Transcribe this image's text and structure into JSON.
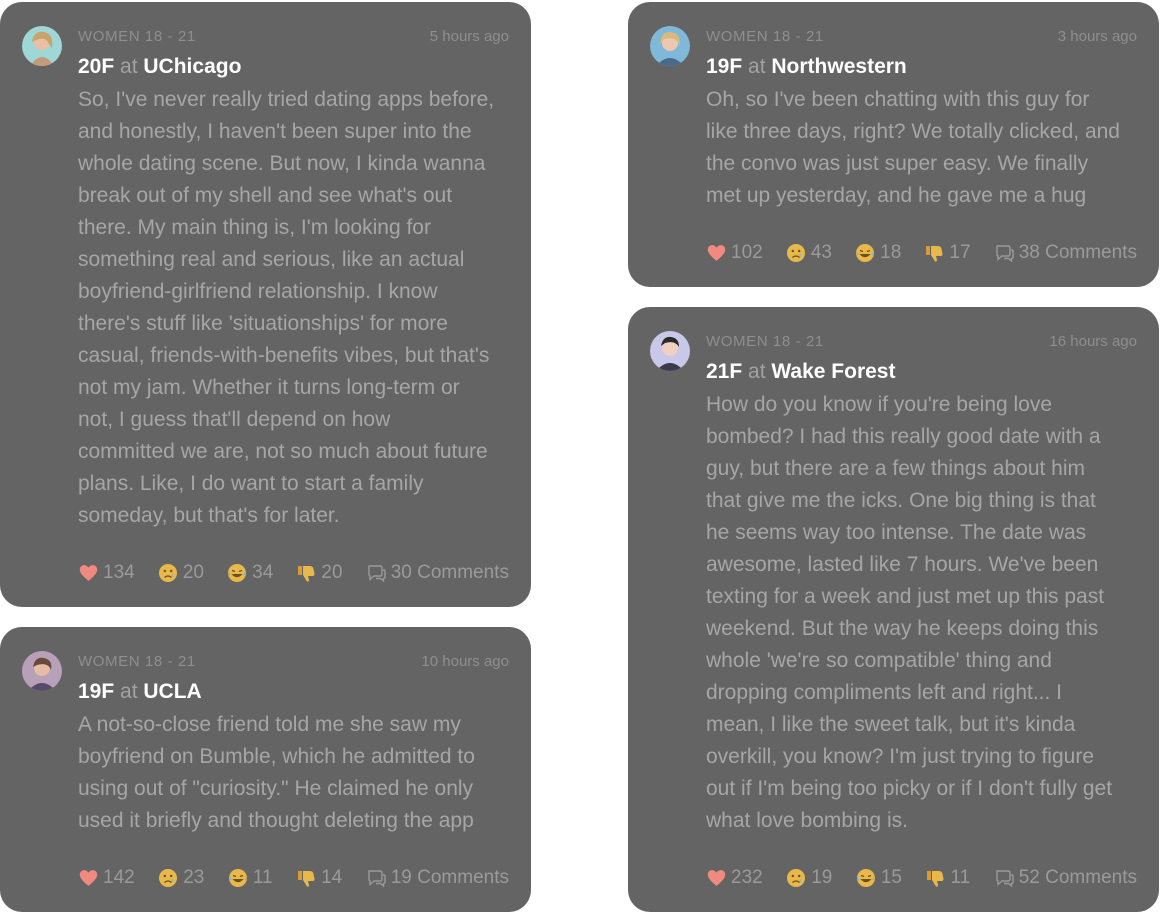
{
  "posts": [
    {
      "category": "WOMEN 18 - 21",
      "time": "5 hours ago",
      "age_gender": "20F",
      "at": "at",
      "school": "UChicago",
      "lines": [
        "So, I've never really tried dating apps before,",
        "and honestly, I haven't been super into the",
        "whole dating scene. But now, I kinda wanna",
        "break out of my shell and see what's out",
        "there. My main thing is, I'm looking for",
        "something real and serious, like an actual",
        "boyfriend-girlfriend relationship. I know",
        "there's stuff like 'situationships' for more",
        "casual, friends-with-benefits vibes, but that's",
        "not my jam. Whether it turns long-term or",
        "not, I guess that'll depend on how",
        "committed we are, not so much about future",
        "plans. Like, I do want to start a family",
        "someday, but that's for later."
      ],
      "hearts": "134",
      "sad": "20",
      "laugh": "34",
      "dislike": "20",
      "comments": "30 Comments"
    },
    {
      "category": "WOMEN 18 - 21",
      "time": "10 hours ago",
      "age_gender": "19F",
      "at": "at",
      "school": "UCLA",
      "lines": [
        "A not-so-close friend told me she saw my",
        "boyfriend on Bumble, which he admitted to",
        "using out of \"curiosity.\" He claimed he only",
        "used it briefly and thought deleting the app"
      ],
      "hearts": "142",
      "sad": "23",
      "laugh": "11",
      "dislike": "14",
      "comments": "19 Comments"
    },
    {
      "category": "WOMEN 18 - 21",
      "time": "3 hours ago",
      "age_gender": "19F",
      "at": "at",
      "school": "Northwestern",
      "lines": [
        "Oh, so I've been chatting with this guy for",
        "like three days, right? We totally clicked, and",
        "the convo was just super easy. We finally",
        "met up yesterday, and he gave me a hug"
      ],
      "hearts": "102",
      "sad": "43",
      "laugh": "18",
      "dislike": "17",
      "comments": "38 Comments"
    },
    {
      "category": "WOMEN 18 - 21",
      "time": "16 hours ago",
      "age_gender": "21F",
      "at": "at",
      "school": "Wake Forest",
      "lines": [
        "How do you know if you're being love",
        "bombed? I had this really good date with a",
        "guy, but there are a few things about him",
        "that give me the icks. One big thing is that",
        "he seems way too intense. The date was",
        "awesome, lasted like 7 hours. We've been",
        "texting for a week and just met up this past",
        "weekend. But the way he keeps doing this",
        "whole 'we're so compatible' thing and",
        "dropping compliments left and right... I",
        "mean, I like the sweet talk, but it's kinda",
        "overkill, you know? I'm just trying to figure",
        "out if I'm being too picky or if I don't fully get",
        "what love bombing is."
      ],
      "hearts": "232",
      "sad": "19",
      "laugh": "15",
      "dislike": "11",
      "comments": "52 Comments"
    }
  ],
  "colors": {
    "card": "#646464",
    "heart": "#f08a80",
    "emoji": "#e8b84a"
  },
  "icons": {
    "heart": "heart-icon",
    "sad": "sad-face-icon",
    "laugh": "laughing-face-icon",
    "dislike": "thumbs-down-icon",
    "comments": "comment-bubble-icon"
  }
}
